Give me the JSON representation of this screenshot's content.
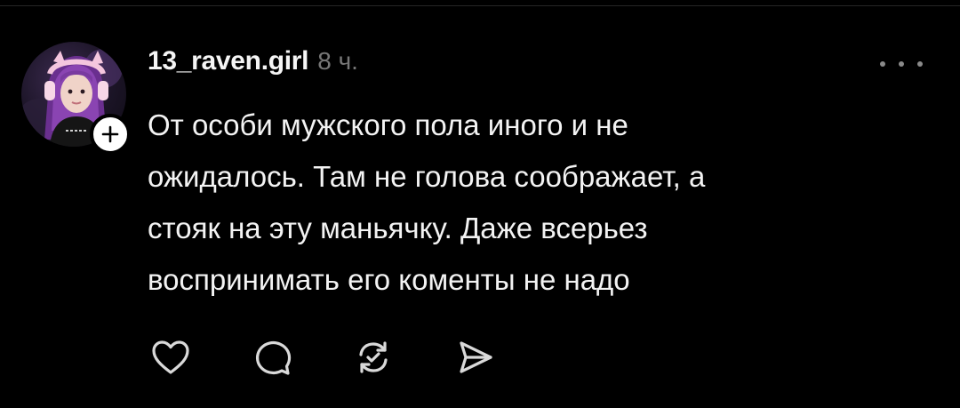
{
  "comment": {
    "username": "13_raven.girl",
    "timestamp": "8 ч.",
    "text_lines": [
      "От особи мужского пола иного и не",
      "ожидалось. Там не голова соображает, а",
      "стояк на эту маньячку. Даже всерьез",
      "воспринимать его коменты не надо"
    ],
    "avatar_icon": "user-avatar-photo",
    "follow_icon": "plus-icon",
    "more_icon": "more-dots-icon"
  },
  "actions": [
    {
      "name": "like",
      "icon": "heart-icon"
    },
    {
      "name": "reply",
      "icon": "comment-bubble-icon"
    },
    {
      "name": "repost",
      "icon": "repost-icon"
    },
    {
      "name": "share",
      "icon": "send-icon"
    }
  ],
  "colors": {
    "background": "#000000",
    "text": "#f3f3f3",
    "muted": "#777777",
    "icon": "#d9d9d9",
    "badge": "#ffffff"
  }
}
